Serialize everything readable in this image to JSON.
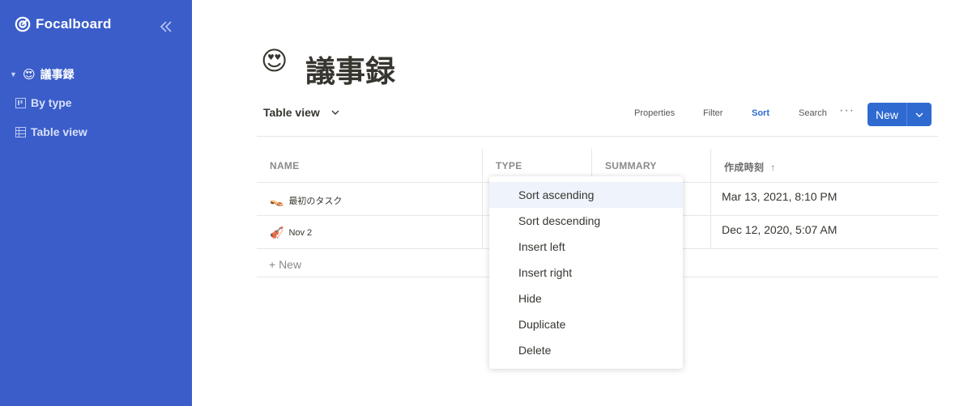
{
  "sidebar": {
    "brand": "Focalboard",
    "board": {
      "emoji": "😍",
      "title": "議事録"
    },
    "views": [
      {
        "label": "By type",
        "icon": "board-view-icon"
      },
      {
        "label": "Table view",
        "icon": "table-view-icon"
      }
    ]
  },
  "page": {
    "emoji": "😍",
    "title": "議事録",
    "view_title": "Table view"
  },
  "toolbar": {
    "properties": "Properties",
    "filter": "Filter",
    "sort": "Sort",
    "search": "Search",
    "more": "···",
    "new": "New"
  },
  "table": {
    "columns": [
      "NAME",
      "TYPE",
      "SUMMARY",
      "作成時刻"
    ],
    "sort_indicator": "↑",
    "rows": [
      {
        "emoji": "👡",
        "name": "最初のタスク",
        "created": "Mar 13, 2021, 8:10 PM"
      },
      {
        "emoji": "🎻",
        "name": "Nov 2",
        "created": "Dec 12, 2020, 5:07 AM"
      }
    ],
    "add_new": "+ New"
  },
  "menu": {
    "items": [
      "Sort ascending",
      "Sort descending",
      "Insert left",
      "Insert right",
      "Hide",
      "Duplicate",
      "Delete"
    ]
  },
  "colors": {
    "sidebar_bg": "#3a5dc9",
    "accent": "#2f6ad1"
  }
}
